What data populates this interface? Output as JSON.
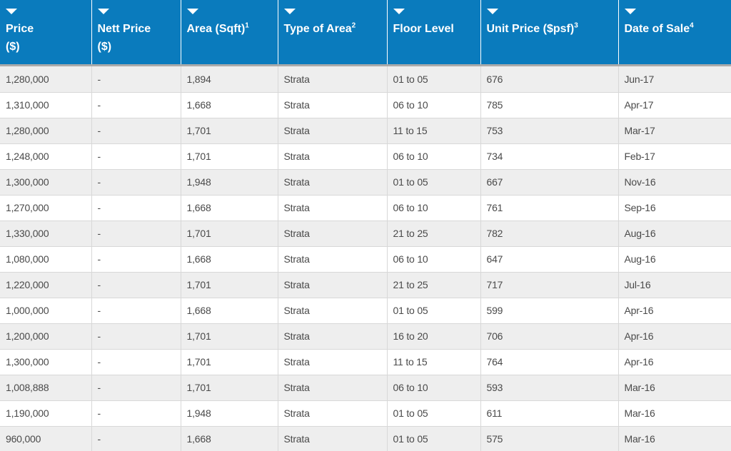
{
  "table": {
    "columns": [
      {
        "label": "Price",
        "label2": "($)",
        "sup": ""
      },
      {
        "label": "Nett Price",
        "label2": "($)",
        "sup": ""
      },
      {
        "label": "Area (Sqft)",
        "label2": "",
        "sup": "1"
      },
      {
        "label": "Type of Area",
        "label2": "",
        "sup": "2"
      },
      {
        "label": "Floor Level",
        "label2": "",
        "sup": ""
      },
      {
        "label": "Unit Price ($psf)",
        "label2": "",
        "sup": "3"
      },
      {
        "label": "Date of Sale",
        "label2": "",
        "sup": "4"
      }
    ],
    "rows": [
      [
        "1,280,000",
        "-",
        "1,894",
        "Strata",
        "01 to 05",
        "676",
        "Jun-17"
      ],
      [
        "1,310,000",
        "-",
        "1,668",
        "Strata",
        "06 to 10",
        "785",
        "Apr-17"
      ],
      [
        "1,280,000",
        "-",
        "1,701",
        "Strata",
        "11 to 15",
        "753",
        "Mar-17"
      ],
      [
        "1,248,000",
        "-",
        "1,701",
        "Strata",
        "06 to 10",
        "734",
        "Feb-17"
      ],
      [
        "1,300,000",
        "-",
        "1,948",
        "Strata",
        "01 to 05",
        "667",
        "Nov-16"
      ],
      [
        "1,270,000",
        "-",
        "1,668",
        "Strata",
        "06 to 10",
        "761",
        "Sep-16"
      ],
      [
        "1,330,000",
        "-",
        "1,701",
        "Strata",
        "21 to 25",
        "782",
        "Aug-16"
      ],
      [
        "1,080,000",
        "-",
        "1,668",
        "Strata",
        "06 to 10",
        "647",
        "Aug-16"
      ],
      [
        "1,220,000",
        "-",
        "1,701",
        "Strata",
        "21 to 25",
        "717",
        "Jul-16"
      ],
      [
        "1,000,000",
        "-",
        "1,668",
        "Strata",
        "01 to 05",
        "599",
        "Apr-16"
      ],
      [
        "1,200,000",
        "-",
        "1,701",
        "Strata",
        "16 to 20",
        "706",
        "Apr-16"
      ],
      [
        "1,300,000",
        "-",
        "1,701",
        "Strata",
        "11 to 15",
        "764",
        "Apr-16"
      ],
      [
        "1,008,888",
        "-",
        "1,701",
        "Strata",
        "06 to 10",
        "593",
        "Mar-16"
      ],
      [
        "1,190,000",
        "-",
        "1,948",
        "Strata",
        "01 to 05",
        "611",
        "Mar-16"
      ],
      [
        "960,000",
        "-",
        "1,668",
        "Strata",
        "01 to 05",
        "575",
        "Mar-16"
      ]
    ]
  },
  "colors": {
    "header_bg": "#0a7bbd",
    "header_text": "#ffffff",
    "row_alt": "#eeeeee",
    "row": "#ffffff",
    "cell_text": "#4a4a4a"
  },
  "icons": {
    "sort": "sort-arrow-down-icon"
  }
}
